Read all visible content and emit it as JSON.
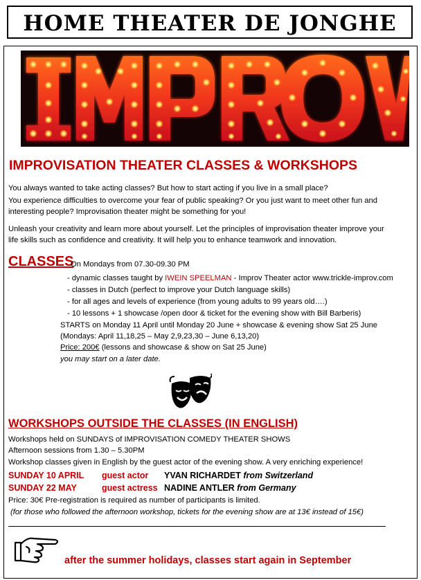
{
  "header": {
    "title": "HOME THEATER DE JONGHE"
  },
  "banner": {
    "word": "IMPROV"
  },
  "main": {
    "title": "IMPROVISATION THEATER CLASSES & WORKSHOPS",
    "intro": [
      "You always wanted to take acting classes? But how to start acting if you live in a small place?",
      "You experience difficulties to overcome your fear of public speaking? Or you just want to meet other fun and",
      "interesting people? Improvisation theater might be something for you!",
      "Unleash your creativity and learn more about yourself. Let the principles of improvisation theater improve your",
      "life skills such as confidence and creativity. It will help you to enhance teamwork and innovation."
    ]
  },
  "classes": {
    "heading": "CLASSES",
    "schedule": "On Mondays from 07.30-09.30 PM",
    "teacher_prefix": "- dynamic classes taught by ",
    "teacher_name": "IWEIN SPEELMAN",
    "teacher_suffix": " - Improv Theater actor www.trickle-improv.com",
    "items": [
      "- classes in Dutch (perfect to improve your Dutch language skills)",
      "- for all ages and levels of experience (from young adults to 99 years old….)",
      "- 10 lessons + 1 showcase /open door & ticket for the evening show with Bill Barberis)"
    ],
    "starts": "STARTS on Monday 11 April until Monday 20 June + showcase & evening show Sat 25 June",
    "dates": "(Mondays: April 11,18,25 – May 2,9,23,30 – June 6,13,20)",
    "price_label": "Price: 200€",
    "price_rest": " (lessons and showcase & show on Sat 25 June)",
    "late": "you may start on a later date."
  },
  "workshops": {
    "heading": "WORKSHOPS OUTSIDE THE CLASSES (IN ENGLISH)",
    "line1": "Workshops held on SUNDAYS of IMPROVISATION COMEDY THEATER SHOWS",
    "line2": "Afternoon sessions from 1.30 – 5.30PM",
    "line3": "Workshop classes given in English by the guest actor of the evening show. A very enriching experience!",
    "sessions": [
      {
        "date": "SUNDAY 10 APRIL",
        "role": "guest actor",
        "name": "YVAN RICHARDET",
        "origin": "from Switzerland"
      },
      {
        "date": "SUNDAY 22 MAY",
        "role": "guest actress",
        "name": "NADINE ANTLER",
        "origin": "from Germany"
      }
    ],
    "price": "Price: 30€ Pre-registration is required as number of participants is limited.",
    "note": "(for those who followed the afternoon workshop, tickets for the evening show are at 13€ instead of 15€)"
  },
  "footer": {
    "separator": "______________________________________________________________________________________________",
    "note": "after the summer holidays, classes start again in September"
  },
  "colors": {
    "accent_red": "#c00000",
    "banner_bg": "#140405",
    "bulb_glow": "#ff5a1f"
  },
  "icons": [
    "theater-masks-icon",
    "pointing-hand-icon"
  ]
}
